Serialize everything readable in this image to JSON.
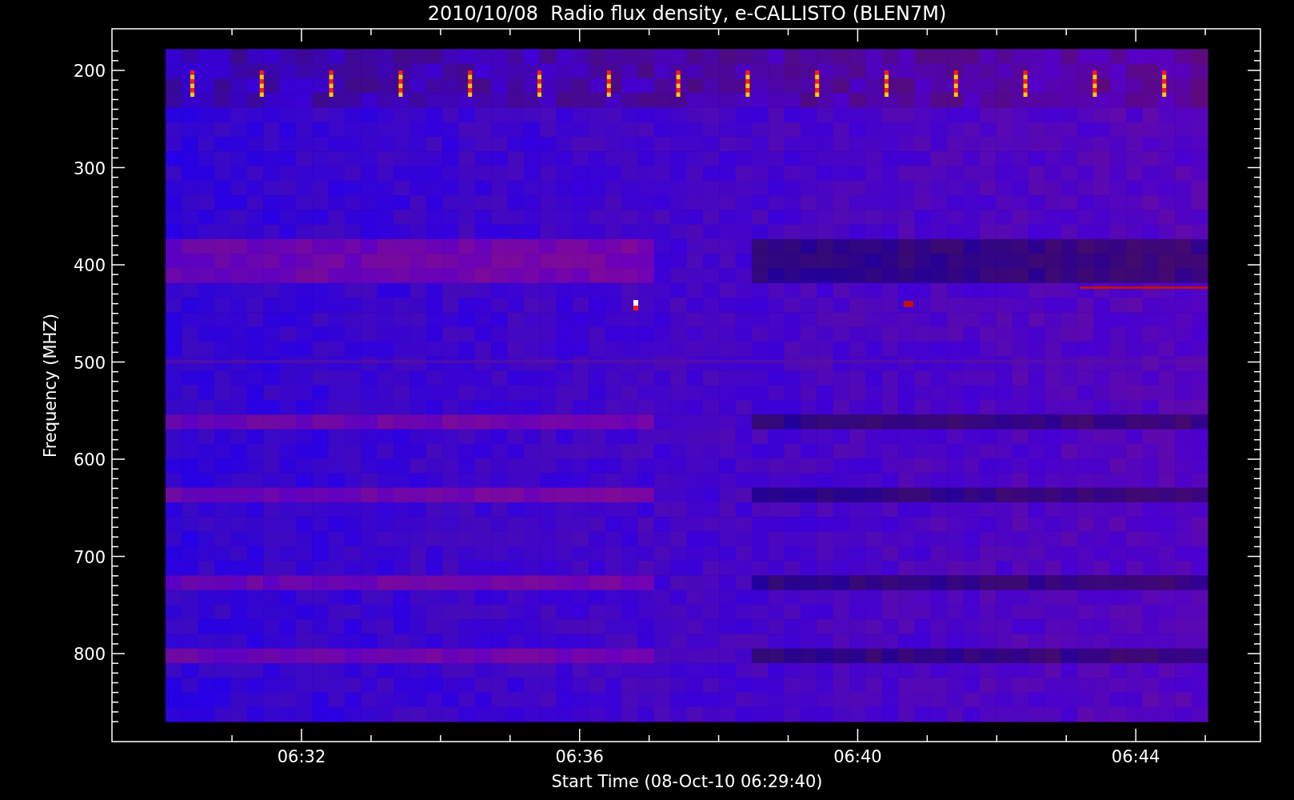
{
  "title": "2010/10/08  Radio flux density, e-CALLISTO (BLEN7M)",
  "y_axis": {
    "label": "Frequency (MHZ)",
    "ticks": [
      "200",
      "300",
      "400",
      "500",
      "600",
      "700",
      "800"
    ]
  },
  "x_axis": {
    "label": "Start Time (08-Oct-10 06:29:40)",
    "ticks": [
      "06:32",
      "06:36",
      "06:40",
      "06:44"
    ]
  }
}
